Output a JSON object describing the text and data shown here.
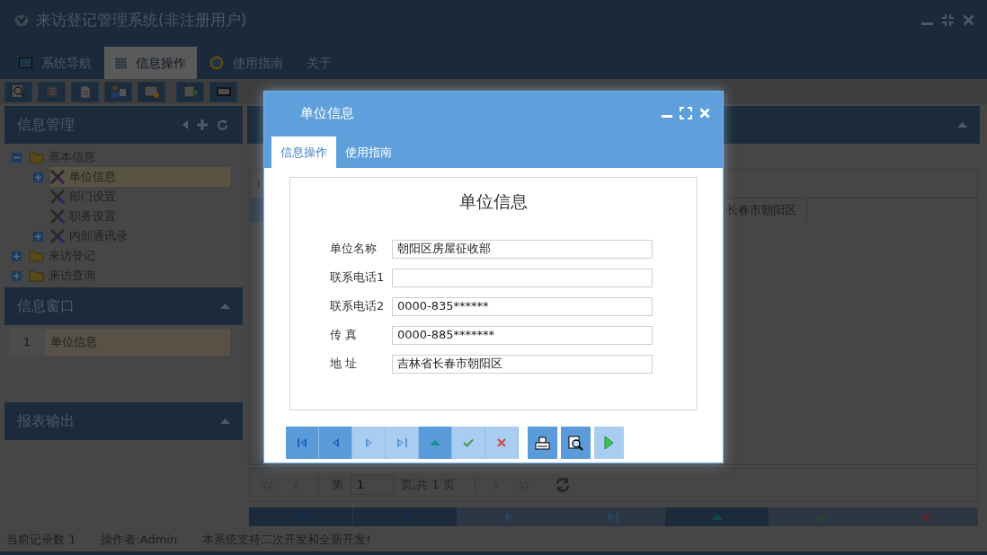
{
  "window": {
    "title": "来访登记管理系统(非注册用户)"
  },
  "menu_tabs": [
    {
      "label": "系统导航",
      "selected": false,
      "kind": "monitor"
    },
    {
      "label": "信息操作",
      "selected": true,
      "kind": "grid"
    },
    {
      "label": "使用指南",
      "selected": false,
      "kind": "help"
    },
    {
      "label": "关于",
      "selected": false,
      "kind": "plain"
    }
  ],
  "toolbar": [
    {
      "kind": "search"
    },
    {
      "kind": "list"
    },
    {
      "kind": "document"
    },
    {
      "kind": "users"
    },
    {
      "kind": "window"
    },
    {
      "kind": "export"
    },
    {
      "kind": "printer"
    }
  ],
  "info_panel": {
    "title": "信息管理",
    "tree": [
      {
        "label": "基本信息",
        "kind": "folder",
        "expanded": true,
        "selected": false,
        "children": [
          {
            "label": "单位信息",
            "kind": "tool",
            "expanded": false,
            "selected": true
          },
          {
            "label": "部门设置",
            "kind": "tool",
            "selected": false
          },
          {
            "label": "职务设置",
            "kind": "tool",
            "selected": false
          },
          {
            "label": "内部通讯录",
            "kind": "tool",
            "expanded": false,
            "selected": false
          }
        ]
      },
      {
        "label": "来访登记",
        "kind": "folder",
        "expanded": false,
        "selected": false
      },
      {
        "label": "来访查询",
        "kind": "folder",
        "expanded": false,
        "selected": false
      }
    ]
  },
  "window_panel": {
    "title": "信息窗口",
    "expanded": true,
    "rows": [
      {
        "index": "1",
        "label": "单位信息",
        "selected": true
      }
    ]
  },
  "report_panel": {
    "title": "报表输出",
    "expanded": true
  },
  "grid": {
    "column_1": "I",
    "rows": [
      {
        "cell": "长春市朝阳区",
        "selected": true
      }
    ]
  },
  "pager": {
    "before": "第",
    "page": "1",
    "after": "页,共 1 页"
  },
  "bottom_nav": [
    {
      "kind": "first",
      "disabled": false
    },
    {
      "kind": "prev",
      "disabled": false
    },
    {
      "kind": "next",
      "disabled": true
    },
    {
      "kind": "last",
      "disabled": true
    },
    {
      "kind": "up",
      "disabled": false
    },
    {
      "kind": "ok",
      "disabled": true
    },
    {
      "kind": "cancel",
      "disabled": true
    }
  ],
  "status_bar": [
    "当前记录数 1",
    "操作者:Admin",
    "本系统支持二次开发和全新开发!"
  ],
  "dialog": {
    "title": "单位信息",
    "tabs": [
      {
        "label": "信息操作",
        "selected": true
      },
      {
        "label": "使用指南",
        "selected": false
      }
    ],
    "form_title": "单位信息",
    "fields": [
      {
        "label": "单位名称",
        "value": "朝阳区房屋征收部"
      },
      {
        "label": "联系电话1"
      },
      {
        "label": "联系电话2",
        "value": "0000-835******"
      },
      {
        "label": "传 真",
        "value": "0000-885*******"
      },
      {
        "label": "地 址",
        "value": "吉林省长春市朝阳区"
      }
    ],
    "nav_buttons": [
      {
        "kind": "first",
        "disabled": false
      },
      {
        "kind": "prev",
        "disabled": false
      },
      {
        "kind": "next",
        "disabled": true
      },
      {
        "kind": "last",
        "disabled": true
      },
      {
        "kind": "up",
        "disabled": false
      },
      {
        "kind": "ok",
        "disabled": true
      },
      {
        "kind": "cancel",
        "disabled": true
      }
    ],
    "action_buttons": [
      {
        "kind": "print",
        "disabled": false
      },
      {
        "kind": "preview",
        "disabled": false
      },
      {
        "kind": "run",
        "disabled": true
      }
    ]
  }
}
